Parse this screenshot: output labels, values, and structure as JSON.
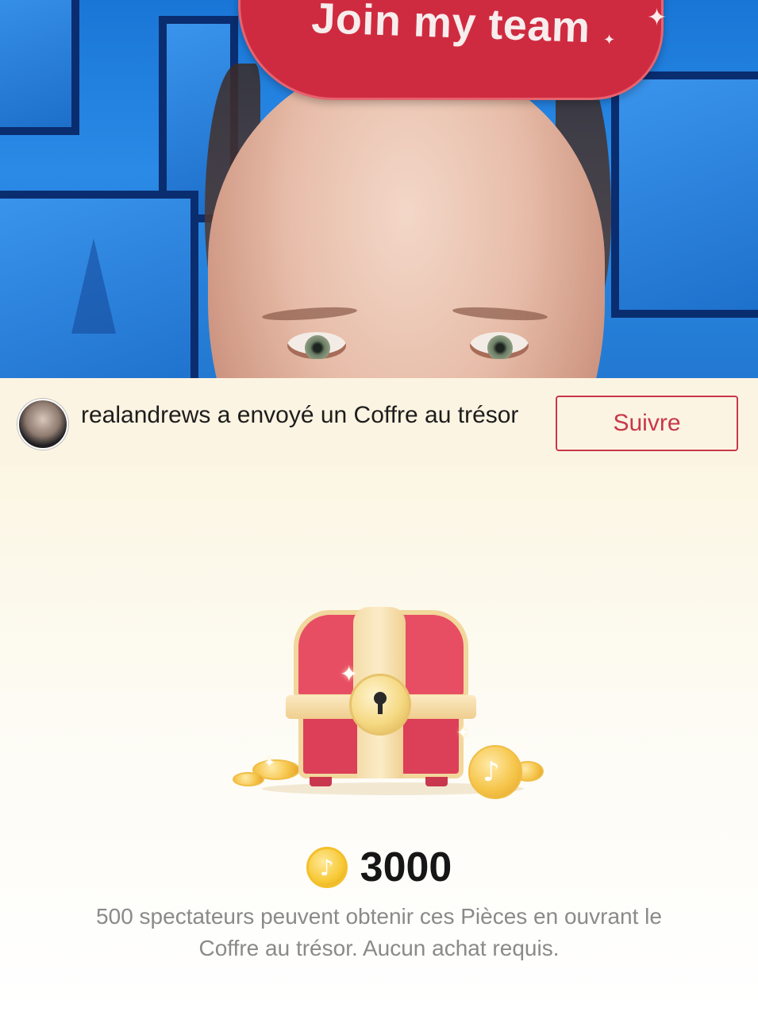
{
  "stream": {
    "banner_text": "Join my team"
  },
  "notification": {
    "message": "realandrews a envoyé un Coffre au trésor",
    "follow_label": "Suivre"
  },
  "treasure": {
    "coin_icon": "tiktok-note-icon",
    "amount": "3000",
    "description": "500 spectateurs peuvent obtenir ces Pièces en ouvrant le Coffre au trésor. Aucun achat requis."
  },
  "colors": {
    "accent_red": "#c8384b",
    "chest_red": "#e74e64",
    "coin_gold": "#f7c936",
    "panel_bg": "#fdf9ec"
  }
}
